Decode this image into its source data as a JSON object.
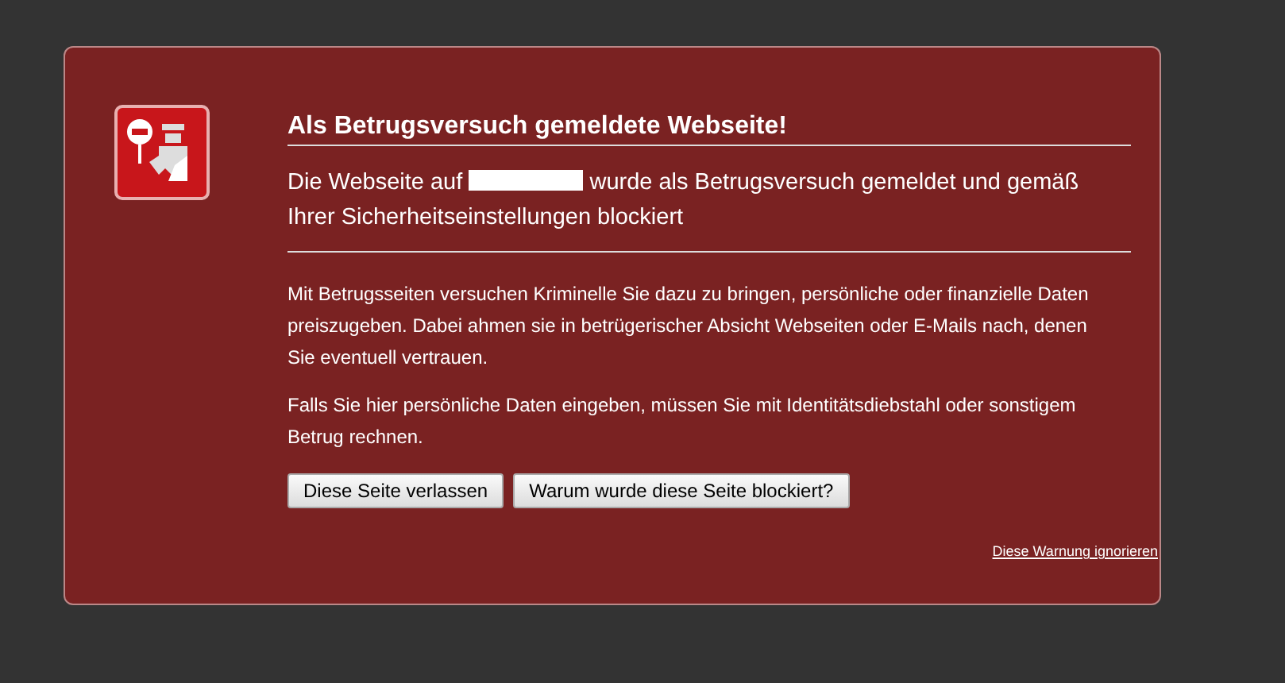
{
  "heading": "Als Betrugsversuch gemeldete Webseite!",
  "intro": {
    "before": "Die Webseite auf",
    "after": "wurde als Betrugsversuch gemeldet und gemäß Ihrer Sicherheitseinstellungen blockiert"
  },
  "paragraphs": [
    "Mit Betrugsseiten versuchen Kriminelle Sie dazu zu bringen, persönliche oder finanzielle Daten preiszugeben. Dabei ahmen sie in betrügerischer Absicht Webseiten oder E-Mails nach, denen Sie eventuell vertrauen.",
    "Falls Sie hier persönliche Daten eingeben, müssen Sie mit Identitätsdiebstahl oder sonstigem Betrug rechnen."
  ],
  "buttons": [
    "Diese Seite verlassen",
    "Warum wurde diese Seite blockiert?"
  ],
  "ignore_link": "Diese Warnung ignorieren"
}
